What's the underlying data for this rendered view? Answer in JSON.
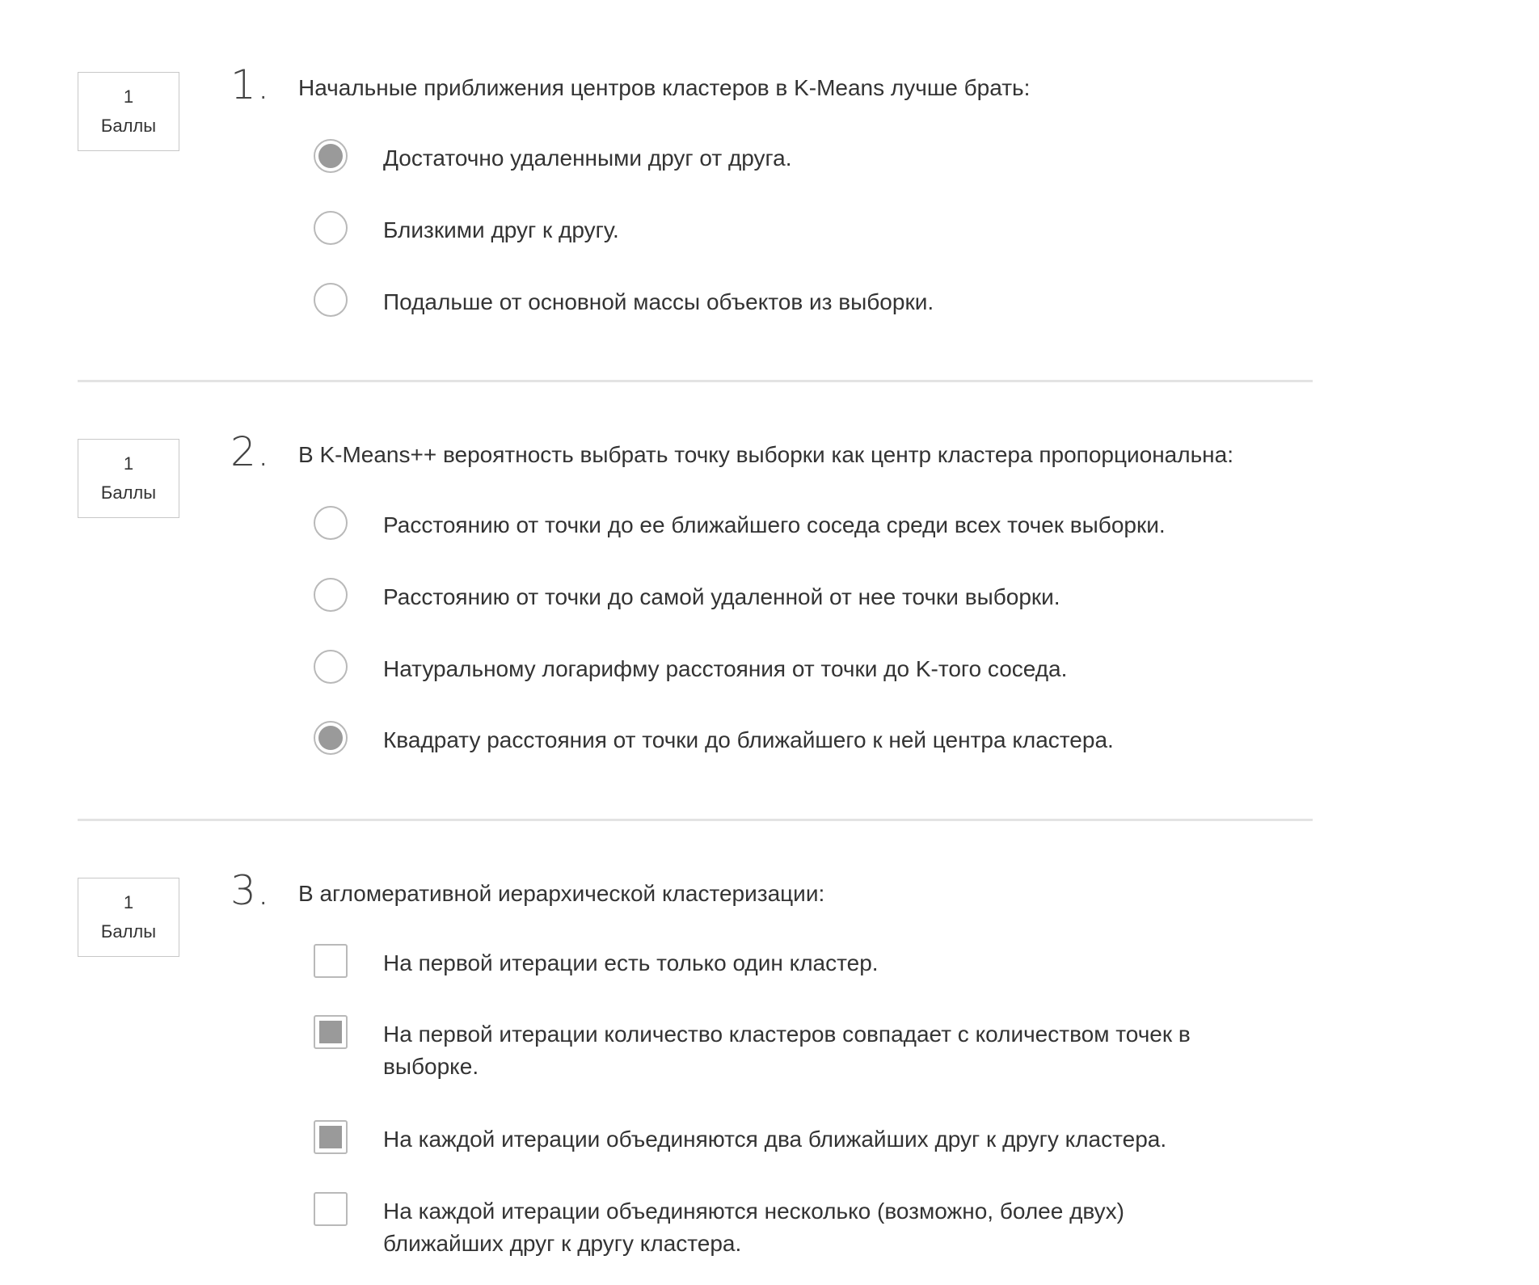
{
  "questions": [
    {
      "number": "1.",
      "points_value": "1",
      "points_label": "Баллы",
      "text": "Начальные приближения центров кластеров в K-Means лучше брать:",
      "input_type": "radio",
      "options": [
        {
          "label": "Достаточно удаленными друг от друга.",
          "selected": true
        },
        {
          "label": "Близкими друг к другу.",
          "selected": false
        },
        {
          "label": "Подальше от основной массы объектов из выборки.",
          "selected": false
        }
      ]
    },
    {
      "number": "2.",
      "points_value": "1",
      "points_label": "Баллы",
      "text": "В K-Means++ вероятность выбрать точку выборки как центр кластера пропорциональна:",
      "input_type": "radio",
      "options": [
        {
          "label": "Расстоянию от точки до ее ближайшего соседа среди всех точек выборки.",
          "selected": false
        },
        {
          "label": "Расстоянию от точки до самой удаленной от нее точки выборки.",
          "selected": false
        },
        {
          "label": "Натуральному логарифму расстояния от точки до K-того соседа.",
          "selected": false
        },
        {
          "label": "Квадрату расстояния от точки до ближайшего к ней центра кластера.",
          "selected": true
        }
      ]
    },
    {
      "number": "3.",
      "points_value": "1",
      "points_label": "Баллы",
      "text": "В агломеративной иерархической кластеризации:",
      "input_type": "checkbox",
      "options": [
        {
          "label": "На первой итерации есть только один кластер.",
          "selected": false
        },
        {
          "label": "На первой итерации количество кластеров совпадает с количеством точек в выборке.",
          "selected": true
        },
        {
          "label": "На каждой итерации объединяются два ближайших друг к другу кластера.",
          "selected": true
        },
        {
          "label": "На каждой итерации объединяются несколько (возможно, более двух) ближайших друг к другу кластера.",
          "selected": false
        }
      ]
    }
  ]
}
